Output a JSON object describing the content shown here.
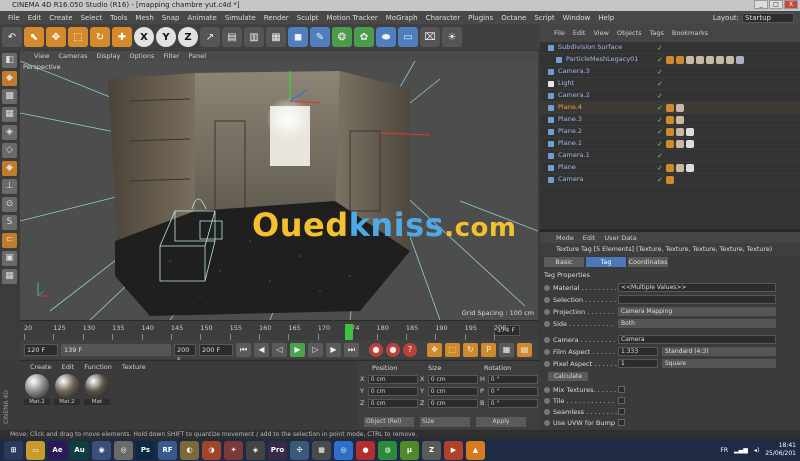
{
  "window": {
    "title": "CINEMA 4D R16.050 Studio (R16) - [mapping chambre yut.c4d *]",
    "buttons": [
      "_",
      "□",
      "X"
    ]
  },
  "menu_bar": [
    "File",
    "Edit",
    "Create",
    "Select",
    "Tools",
    "Mesh",
    "Snap",
    "Animate",
    "Simulate",
    "Render",
    "Sculpt",
    "Motion Tracker",
    "MoGraph",
    "Character",
    "Plugins",
    "Octane",
    "Script",
    "Window",
    "Help"
  ],
  "layout": {
    "label": "Layout:",
    "value": "Startup"
  },
  "toolbar": {
    "items": [
      {
        "icon": "undo-icon",
        "glyph": "↶",
        "style": ""
      },
      {
        "icon": "live-select-icon",
        "glyph": "⬉",
        "style": "o"
      },
      {
        "icon": "move-icon",
        "glyph": "✥",
        "style": "o"
      },
      {
        "icon": "scale-icon",
        "glyph": "⬚",
        "style": "o"
      },
      {
        "icon": "rotate-icon",
        "glyph": "↻",
        "style": "o"
      },
      {
        "icon": "add-icon",
        "glyph": "✚",
        "style": "o"
      },
      {
        "icon": "x-axis-icon",
        "glyph": "X",
        "style": "xyz"
      },
      {
        "icon": "y-axis-icon",
        "glyph": "Y",
        "style": "xyz"
      },
      {
        "icon": "z-axis-icon",
        "glyph": "Z",
        "style": "xyz"
      },
      {
        "icon": "coordinate-system-icon",
        "glyph": "↗",
        "style": ""
      },
      {
        "icon": "render-view-icon",
        "glyph": "▤",
        "style": ""
      },
      {
        "icon": "render-picture-viewer-icon",
        "glyph": "▥",
        "style": ""
      },
      {
        "icon": "render-settings-icon",
        "glyph": "▦",
        "style": ""
      },
      {
        "icon": "cube-icon",
        "glyph": "◼",
        "style": "b"
      },
      {
        "icon": "pen-icon",
        "glyph": "✎",
        "style": "b"
      },
      {
        "icon": "subdivision-icon",
        "glyph": "❂",
        "style": "g"
      },
      {
        "icon": "array-icon",
        "glyph": "✿",
        "style": "g"
      },
      {
        "icon": "deformer-icon",
        "glyph": "⬬",
        "style": "b"
      },
      {
        "icon": "floor-icon",
        "glyph": "▭",
        "style": "b"
      },
      {
        "icon": "camera-icon",
        "glyph": "⌧",
        "style": ""
      },
      {
        "icon": "light-icon",
        "glyph": "☀",
        "style": ""
      }
    ]
  },
  "left_tools": [
    {
      "icon": "make-editable-icon",
      "glyph": "◧",
      "style": ""
    },
    {
      "icon": "model-mode-icon",
      "glyph": "◆",
      "style": "o"
    },
    {
      "icon": "texture-mode-icon",
      "glyph": "▩",
      "style": ""
    },
    {
      "icon": "workplane-icon",
      "glyph": "▦",
      "style": ""
    },
    {
      "icon": "points-mode-icon",
      "glyph": "◈",
      "style": ""
    },
    {
      "icon": "edges-mode-icon",
      "glyph": "◇",
      "style": ""
    },
    {
      "icon": "polygons-mode-icon",
      "glyph": "◆",
      "style": "o"
    },
    {
      "icon": "axis-icon",
      "glyph": "⊥",
      "style": ""
    },
    {
      "icon": "tweak-icon",
      "glyph": "⊙",
      "style": ""
    },
    {
      "icon": "snap-icon",
      "glyph": "S",
      "style": ""
    },
    {
      "icon": "magnet-icon",
      "glyph": "⊂",
      "style": "o"
    },
    {
      "icon": "lock-workplane-icon",
      "glyph": "▣",
      "style": ""
    },
    {
      "icon": "grid-icon",
      "glyph": "▦",
      "style": ""
    }
  ],
  "viewport": {
    "menu": [
      "View",
      "Cameras",
      "Display",
      "Options",
      "Filter",
      "Panel"
    ],
    "label": "Perspective",
    "grid_spacing": "Grid Spacing : 100 cm"
  },
  "timeline": {
    "ticks": [
      "20",
      "125",
      "130",
      "135",
      "140",
      "145",
      "150",
      "155",
      "160",
      "165",
      "170",
      "174",
      "180",
      "185",
      "190",
      "195",
      "200"
    ],
    "current": "174",
    "frame_field": "174 F"
  },
  "transport": {
    "start_field": "120 F",
    "start2_field": "139 F",
    "end2_field": "200 F",
    "end_field": "200 F",
    "buttons": [
      {
        "icon": "go-to-start-icon",
        "glyph": "⏮",
        "style": ""
      },
      {
        "icon": "prev-key-icon",
        "glyph": "◀",
        "style": ""
      },
      {
        "icon": "prev-frame-icon",
        "glyph": "◁",
        "style": ""
      },
      {
        "icon": "play-icon",
        "glyph": "▶",
        "style": "g"
      },
      {
        "icon": "next-frame-icon",
        "glyph": "▷",
        "style": ""
      },
      {
        "icon": "next-key-icon",
        "glyph": "▶",
        "style": ""
      },
      {
        "icon": "go-to-end-icon",
        "glyph": "⏭",
        "style": ""
      },
      {
        "icon": "record-key-icon",
        "glyph": "●",
        "style": "r"
      },
      {
        "icon": "autokey-icon",
        "glyph": "●",
        "style": "r"
      },
      {
        "icon": "keyframe-selection-icon",
        "glyph": "?",
        "style": "r"
      },
      {
        "icon": "position-key-icon",
        "glyph": "✥",
        "style": "o"
      },
      {
        "icon": "scale-key-icon",
        "glyph": "⬚",
        "style": "o"
      },
      {
        "icon": "rotation-key-icon",
        "glyph": "↻",
        "style": "o"
      },
      {
        "icon": "param-key-icon",
        "glyph": "P",
        "style": "o"
      },
      {
        "icon": "pla-key-icon",
        "glyph": "▦",
        "style": ""
      },
      {
        "icon": "timeline-icon",
        "glyph": "▤",
        "style": "o"
      }
    ]
  },
  "material_manager": {
    "brand": "CINEMA 4D",
    "menu": [
      "Create",
      "Edit",
      "Function",
      "Texture"
    ],
    "materials": [
      {
        "name": "Mat.2",
        "color": "#8c8c8c"
      },
      {
        "name": "Mat.2",
        "color": "#6e6457"
      },
      {
        "name": "Mat",
        "color": "#5a5246"
      }
    ]
  },
  "coordinates": {
    "headers": [
      "Position",
      "Size",
      "Rotation"
    ],
    "rows": [
      {
        "axis": "X",
        "pos": "0 cm",
        "sax": "X",
        "size": "0 cm",
        "rax": "H",
        "rot": "0 °"
      },
      {
        "axis": "Y",
        "pos": "0 cm",
        "sax": "Y",
        "size": "0 cm",
        "rax": "P",
        "rot": "0 °"
      },
      {
        "axis": "Z",
        "pos": "0 cm",
        "sax": "Z",
        "size": "0 cm",
        "rax": "B",
        "rot": "0 °"
      }
    ],
    "mode": "Object (Rel)",
    "size_mode": "Size",
    "apply": "Apply"
  },
  "object_manager": {
    "menu": [
      "File",
      "Edit",
      "View",
      "Objects",
      "Tags",
      "Bookmarks"
    ],
    "objects": [
      {
        "name": "Subdivision Surface",
        "indent": 0,
        "orange": false,
        "tags": []
      },
      {
        "name": "ParticleMeshLegacy01",
        "indent": 1,
        "orange": false,
        "tags": [
          "#d08a2e",
          "#d08a2e",
          "#c8b9a6",
          "#c8b9a6",
          "#c8b9a6",
          "#c8b9a6",
          "#c8b9a6",
          "#aab0c8"
        ]
      },
      {
        "name": "Camera.3",
        "indent": 0,
        "orange": false,
        "tags": []
      },
      {
        "name": "Light",
        "indent": 0,
        "orange": false,
        "tags": []
      },
      {
        "name": "Camera.2",
        "indent": 0,
        "orange": false,
        "tags": []
      },
      {
        "name": "Plane.4",
        "indent": 0,
        "orange": true,
        "tags": [
          "#d08a2e",
          "#c8b9a6"
        ]
      },
      {
        "name": "Plane.3",
        "indent": 0,
        "orange": false,
        "tags": [
          "#d08a2e",
          "#c8b9a6"
        ]
      },
      {
        "name": "Plane.2",
        "indent": 0,
        "orange": false,
        "tags": [
          "#d08a2e",
          "#c8b9a6",
          "#dddddd"
        ]
      },
      {
        "name": "Plane.1",
        "indent": 0,
        "orange": false,
        "tags": [
          "#d08a2e",
          "#c8b9a6",
          "#dddddd"
        ]
      },
      {
        "name": "Camera.1",
        "indent": 0,
        "orange": false,
        "tags": []
      },
      {
        "name": "Plane",
        "indent": 0,
        "orange": false,
        "tags": [
          "#d08a2e",
          "#c8b9a6",
          "#dddddd"
        ]
      },
      {
        "name": "Camera",
        "indent": 0,
        "orange": false,
        "tags": [
          "#d08a2e"
        ]
      }
    ]
  },
  "attribute_manager": {
    "menu": [
      "Mode",
      "Edit",
      "User Data"
    ],
    "title": "Texture Tag [5 Elements] (Texture, Texture, Texture, Texture, Texture)",
    "tabs": [
      "Basic",
      "Tag",
      "Coordinates"
    ],
    "section": "Tag Properties",
    "fields": [
      {
        "label": "Material . . . . . . . . .",
        "value": "<<Multiple Values>>"
      },
      {
        "label": "Selection . . . . . . . .",
        "value": ""
      },
      {
        "label": "Projection . . . . . . .",
        "value": "Camera Mapping"
      },
      {
        "label": "Side . . . . . . . . . . .",
        "value": "Both"
      },
      {
        "label": "Camera . . . . . . . . .",
        "value": "Camera"
      },
      {
        "label": "Film Aspect . . . . . .",
        "value": "1.333",
        "extra": "Standard (4:3)"
      },
      {
        "label": "Pixel Aspect . . . . . .",
        "value": "1",
        "extra": "Square"
      }
    ],
    "calculate": "Calculate",
    "checks": [
      "Mix Textures. . . . . . .",
      "Tile . . . . . . . . . . . .",
      "Seamless . . . . . . . .",
      "Use UVW for Bump"
    ]
  },
  "status": "Move: Click and drag to move elements. Hold down SHIFT to quantize movement / add to the selection in point mode, CTRL to remove.",
  "taskbar": {
    "apps": [
      {
        "icon": "windows-start-icon",
        "glyph": "⊞",
        "color": "#2a3a5e"
      },
      {
        "icon": "file-explorer-icon",
        "glyph": "▭",
        "color": "#c99a2e"
      },
      {
        "icon": "after-effects-icon",
        "glyph": "Ae",
        "color": "#2b1a57"
      },
      {
        "icon": "audition-icon",
        "glyph": "Au",
        "color": "#0f3f3f"
      },
      {
        "icon": "cinema4d-icon",
        "glyph": "◉",
        "color": "#3a4f7a"
      },
      {
        "icon": "chrome-icon",
        "glyph": "◎",
        "color": "#6a6a6a"
      },
      {
        "icon": "photoshop-icon",
        "glyph": "Ps",
        "color": "#0c2a45"
      },
      {
        "icon": "realflow-icon",
        "glyph": "RF",
        "color": "#3a5a8a"
      },
      {
        "icon": "media-icon",
        "glyph": "◐",
        "color": "#7a6a3a"
      },
      {
        "icon": "app-icon",
        "glyph": "◑",
        "color": "#a0442a"
      },
      {
        "icon": "wizard-icon",
        "glyph": "✦",
        "color": "#7a3a3a"
      },
      {
        "icon": "davinci-icon",
        "glyph": "◈",
        "color": "#444"
      },
      {
        "icon": "premiere-pro-icon",
        "glyph": "Pro",
        "color": "#3a2a4a"
      },
      {
        "icon": "network-icon",
        "glyph": "✣",
        "color": "#3a5a7a"
      },
      {
        "icon": "tools-icon",
        "glyph": "▦",
        "color": "#4a4a4a"
      },
      {
        "icon": "chrome-2-icon",
        "glyph": "◎",
        "color": "#2f6ec9"
      },
      {
        "icon": "record-icon",
        "glyph": "●",
        "color": "#b32f2f"
      },
      {
        "icon": "spotify-icon",
        "glyph": "◍",
        "color": "#2d8a3c"
      },
      {
        "icon": "utorrent-icon",
        "glyph": "μ",
        "color": "#4f8a2a"
      },
      {
        "icon": "zbrush-icon",
        "glyph": "Z",
        "color": "#5a5a5a"
      },
      {
        "icon": "player-icon",
        "glyph": "▶",
        "color": "#b0422a"
      },
      {
        "icon": "vlc-icon",
        "glyph": "▲",
        "color": "#d67a1e"
      }
    ],
    "lang": "FR",
    "time": "18:41",
    "date": "25/06/201"
  },
  "watermark": {
    "part1": "Oued",
    "part2": "kniss",
    "part3": ".com"
  }
}
